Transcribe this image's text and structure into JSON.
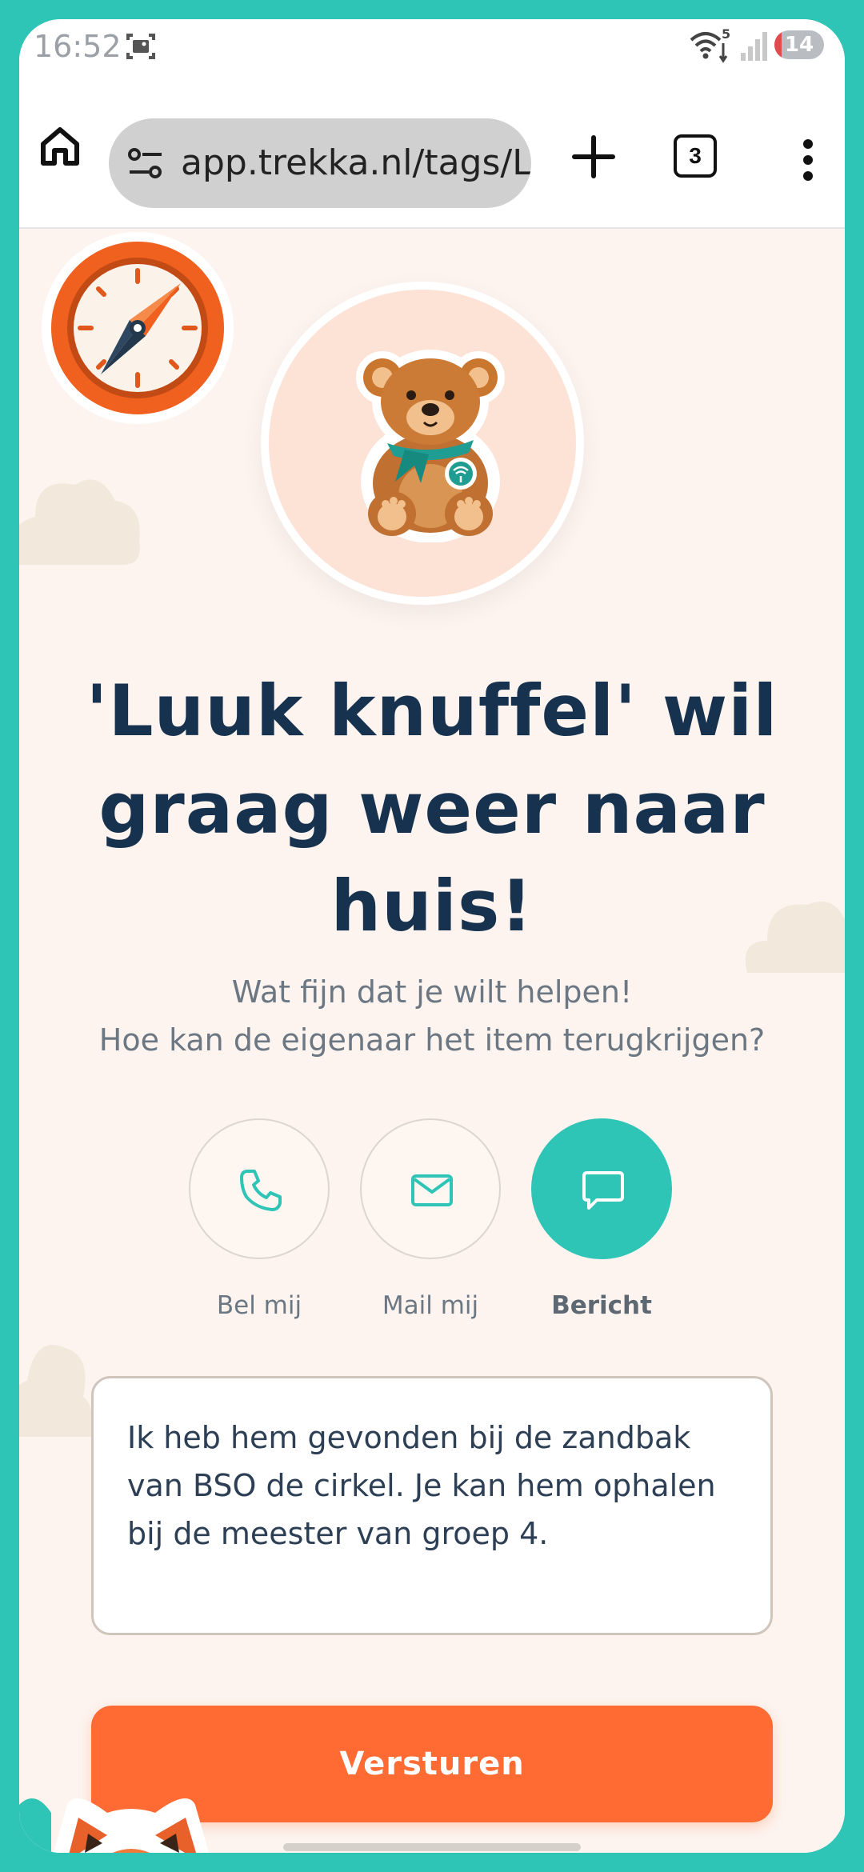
{
  "status_bar": {
    "time": "16:52",
    "wifi_badge": "5",
    "battery_level": "14",
    "battery_fraction": 0.14
  },
  "browser": {
    "url": "app.trekka.nl/tags/Le",
    "tab_count": "3"
  },
  "page": {
    "headline": "'Luuk knuffel' wil graag weer naar huis!",
    "subtitle_line1": "Wat fijn dat je wilt helpen!",
    "subtitle_line2": "Hoe kan de eigenaar het item terugkrijgen?",
    "contact_options": [
      {
        "label": "Bel mij",
        "icon": "phone-icon",
        "selected": false
      },
      {
        "label": "Mail mij",
        "icon": "mail-icon",
        "selected": false
      },
      {
        "label": "Bericht",
        "icon": "message-icon",
        "selected": true
      }
    ],
    "message_value": "Ik heb hem gevonden bij de zandbak van BSO de cirkel. Je kan hem ophalen bij de meester van groep 4.",
    "submit_label": "Versturen"
  },
  "colors": {
    "frame": "#2ec4b6",
    "accent_teal": "#2ec4b6",
    "accent_orange": "#ff6b33",
    "headline": "#17324f",
    "page_bg": "#fdf4ef"
  }
}
